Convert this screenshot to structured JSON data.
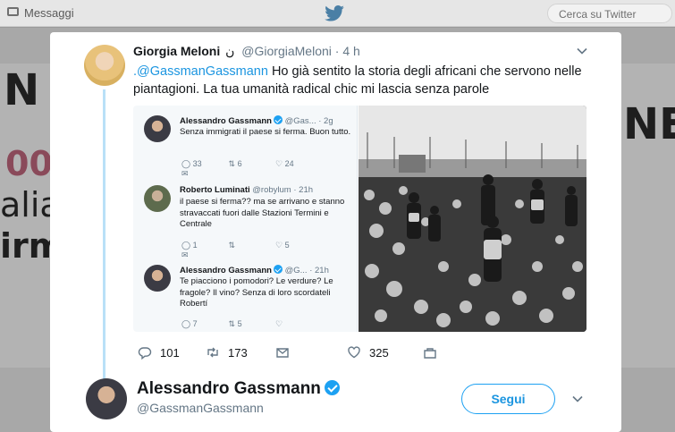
{
  "topbar": {
    "messages_label": "Messaggi",
    "search_placeholder": "Cerca su Twitter",
    "brand_icon": "twitter-bird-icon",
    "accent": "#1da1f2"
  },
  "background": {
    "letters": [
      "N",
      "00",
      "alia",
      "irm",
      "NE"
    ]
  },
  "tweet": {
    "author_name": "Giorgia Meloni",
    "author_symbol": "ن",
    "author_handle": "@GiorgiaMeloni",
    "separator": " · ",
    "time": "4 h",
    "mention": ".@GassmanGassmann",
    "text": " Ho già sentito la storia degli africani che servono nelle piantagioni. La tua umanità radical chic mi lascia senza parole",
    "stats": {
      "replies": "101",
      "retweets": "173",
      "likes": "325"
    }
  },
  "screenshot_replies": [
    {
      "name": "Alessandro Gassmann",
      "handle": "@Gas...",
      "time": "· 2g",
      "verified": true,
      "text": "Senza immigrati il paese si ferma. Buon tutto.",
      "replies": "33",
      "retweets": "6",
      "likes": "24"
    },
    {
      "name": "Roberto Luminati",
      "handle": "@robylum",
      "time": "· 21h",
      "verified": false,
      "text": "il paese si ferma?? ma se arrivano e stanno stravaccati fuori dalle Stazioni Termini e Centrale",
      "replies": "1",
      "retweets": "",
      "likes": "5"
    },
    {
      "name": "Alessandro Gassmann",
      "handle": "@G...",
      "time": "· 21h",
      "verified": true,
      "text": "Te piacciono i pomodori? Le verdure? Le fragole? Il vino? Senza di loro scordateli Robertí",
      "replies": "7",
      "retweets": "5",
      "likes": ""
    }
  ],
  "recommended": {
    "name": "Alessandro Gassmann",
    "handle": "@GassmanGassmann",
    "follow_label": "Segui"
  }
}
